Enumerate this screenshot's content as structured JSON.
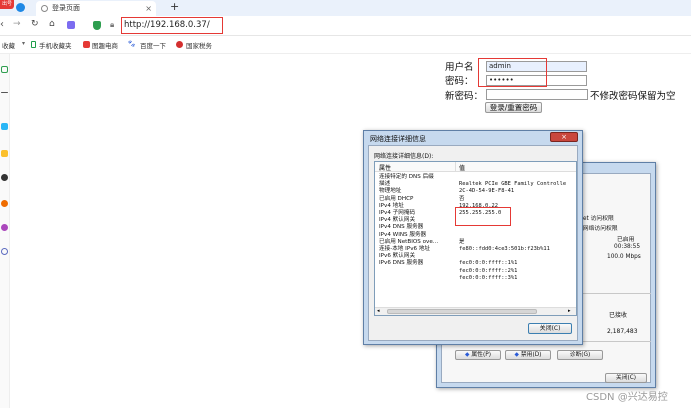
{
  "browser": {
    "badge": "出号",
    "tab_title": "登录页面",
    "new_tab": "+",
    "url": "http://192.168.0.37/",
    "bookmarks": [
      "收藏",
      "手机收藏夹",
      "图趣电商",
      "百度一下",
      "国家税务"
    ]
  },
  "login_form": {
    "username_label": "用户名",
    "username_value": "admin",
    "password_label": "密码：",
    "password_value": "••••••",
    "new_password_label": "新密码：",
    "new_password_hint": "不修改密码保留为空",
    "submit_label": "登录/重置密码"
  },
  "details_dialog": {
    "title": "网络连接详细信息",
    "section_label": "网络连接详细信息(D):",
    "col_property": "属性",
    "col_value": "值",
    "rows": [
      {
        "p": "连接特定的 DNS 后缀",
        "v": ""
      },
      {
        "p": "描述",
        "v": "Realtek PCIe GBE Family Controlle"
      },
      {
        "p": "物理地址",
        "v": "2C-4D-54-9E-F8-41"
      },
      {
        "p": "已启用 DHCP",
        "v": "否"
      },
      {
        "p": "IPv4 地址",
        "v": "192.168.0.22"
      },
      {
        "p": "IPv4 子网掩码",
        "v": "255.255.255.0"
      },
      {
        "p": "IPv4 默认网关",
        "v": ""
      },
      {
        "p": "IPv4 DNS 服务器",
        "v": ""
      },
      {
        "p": "IPv4 WINS 服务器",
        "v": ""
      },
      {
        "p": "已启用 NetBIOS ove...",
        "v": "是"
      },
      {
        "p": "连接-本地 IPv6 地址",
        "v": "fe80::fdd0:4ce3:501b:f23b%11"
      },
      {
        "p": "IPv6 默认网关",
        "v": ""
      },
      {
        "p": "IPv6 DNS 服务器",
        "v": "fec0:0:0:ffff::1%1"
      },
      {
        "p": "",
        "v": "fec0:0:0:ffff::2%1"
      },
      {
        "p": "",
        "v": "fec0:0:0:ffff::3%1"
      }
    ],
    "close_label": "关闭(C)"
  },
  "status_dialog": {
    "ipv4": "rnet 访问权限",
    "ipv6": "无网络访问权限",
    "media": "已启用",
    "duration": "00:38:55",
    "speed": "100.0 Mbps",
    "received_label": "已接收",
    "received_bytes": "2,187,483",
    "properties_label": "属性(P)",
    "disable_label": "禁用(D)",
    "diagnose_label": "诊断(G)",
    "close_label": "关闭(C)"
  },
  "watermark": "CSDN @兴达易控"
}
